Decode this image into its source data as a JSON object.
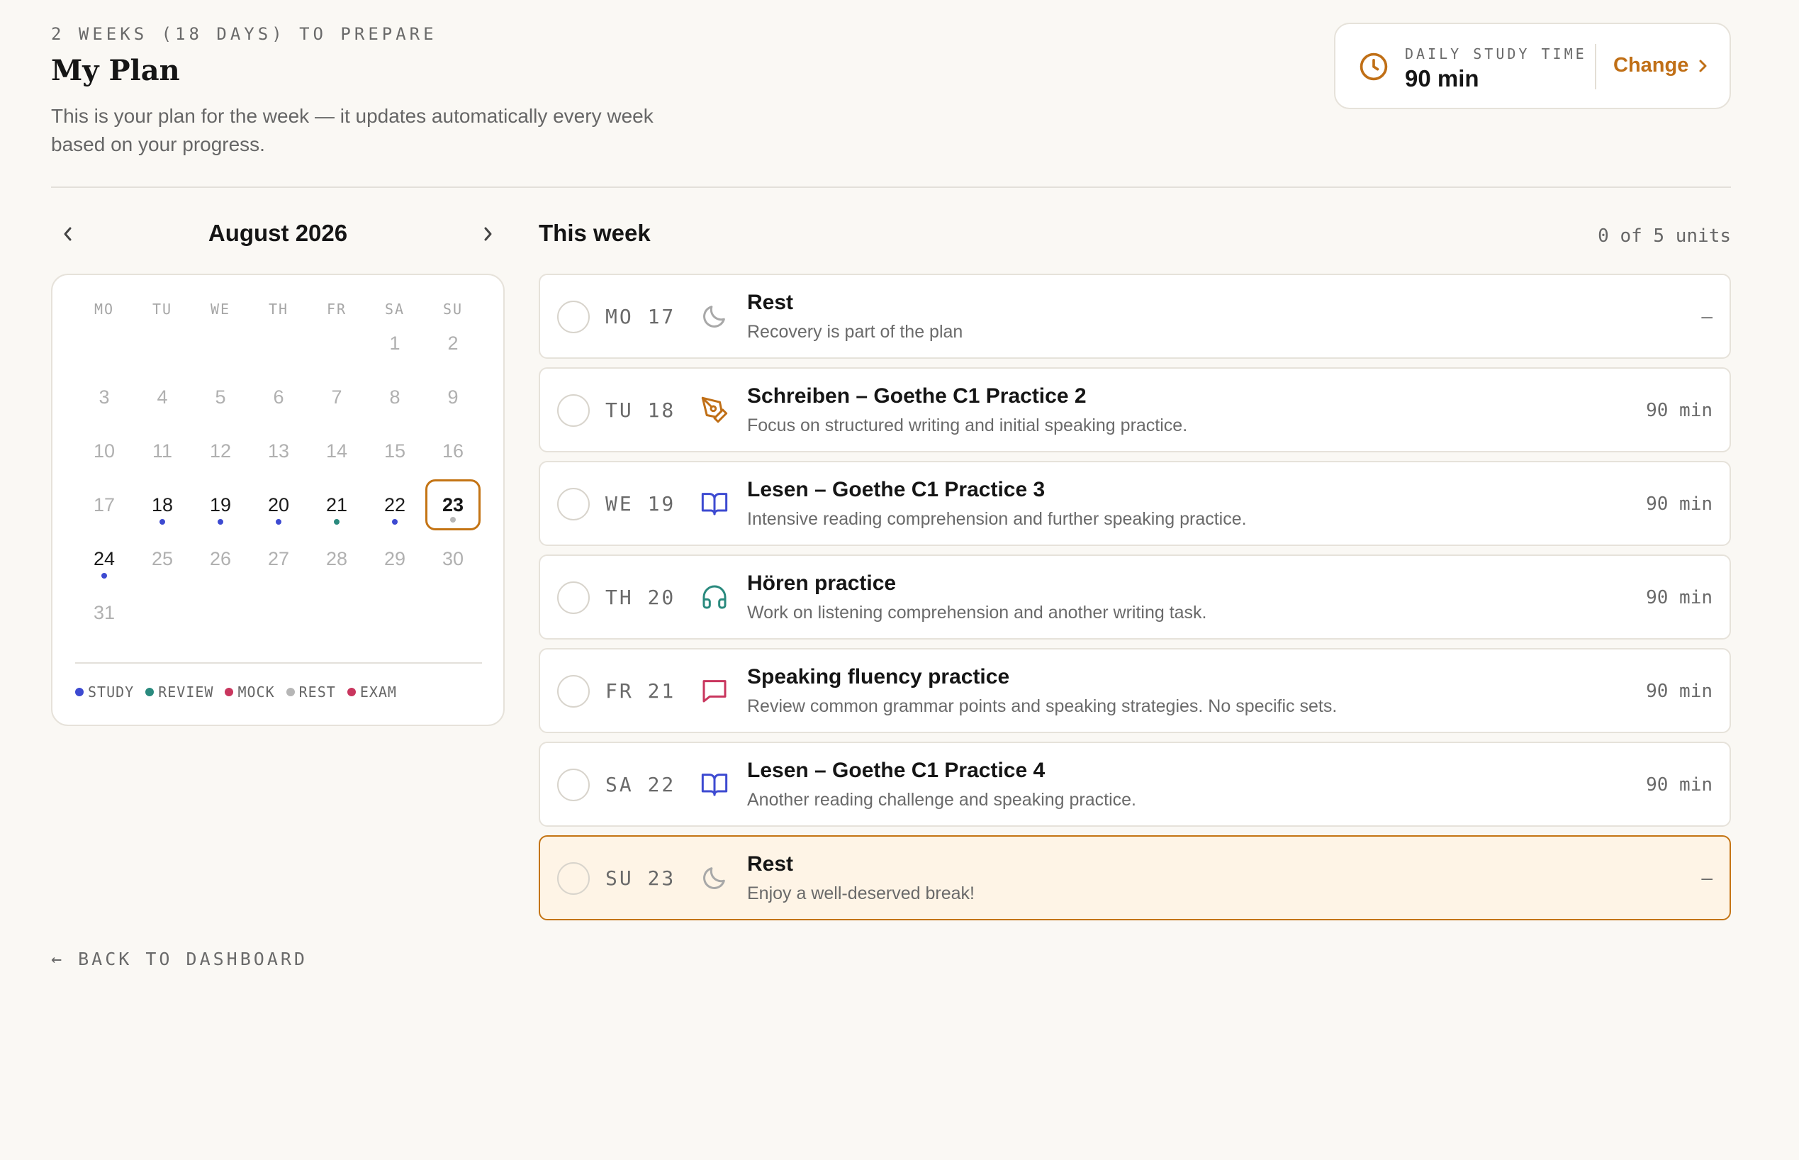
{
  "header": {
    "eyebrow": "2 WEEKS (18 DAYS) TO PREPARE",
    "title": "My Plan",
    "subtitle": "This is your plan for the week — it updates automatically every week based on your progress."
  },
  "study_time": {
    "icon": "clock-icon",
    "label": "DAILY STUDY TIME",
    "value": "90 min",
    "change_label": "Change"
  },
  "calendar": {
    "month": "August 2026",
    "weekdays": [
      "MO",
      "TU",
      "WE",
      "TH",
      "FR",
      "SA",
      "SU"
    ],
    "first_weekday_index": 5,
    "days": [
      {
        "d": "1",
        "active": false
      },
      {
        "d": "2",
        "active": false
      },
      {
        "d": "3",
        "active": false
      },
      {
        "d": "4",
        "active": false
      },
      {
        "d": "5",
        "active": false
      },
      {
        "d": "6",
        "active": false
      },
      {
        "d": "7",
        "active": false
      },
      {
        "d": "8",
        "active": false
      },
      {
        "d": "9",
        "active": false
      },
      {
        "d": "10",
        "active": false
      },
      {
        "d": "11",
        "active": false
      },
      {
        "d": "12",
        "active": false
      },
      {
        "d": "13",
        "active": false
      },
      {
        "d": "14",
        "active": false
      },
      {
        "d": "15",
        "active": false
      },
      {
        "d": "16",
        "active": false
      },
      {
        "d": "17",
        "active": false
      },
      {
        "d": "18",
        "active": true,
        "dot": "study"
      },
      {
        "d": "19",
        "active": true,
        "dot": "study"
      },
      {
        "d": "20",
        "active": true,
        "dot": "study"
      },
      {
        "d": "21",
        "active": true,
        "dot": "review"
      },
      {
        "d": "22",
        "active": true,
        "dot": "study"
      },
      {
        "d": "23",
        "active": true,
        "dot": "rest",
        "today": true
      },
      {
        "d": "24",
        "active": true,
        "dot": "study"
      },
      {
        "d": "25",
        "active": false
      },
      {
        "d": "26",
        "active": false
      },
      {
        "d": "27",
        "active": false
      },
      {
        "d": "28",
        "active": false
      },
      {
        "d": "29",
        "active": false
      },
      {
        "d": "30",
        "active": false
      },
      {
        "d": "31",
        "active": false
      }
    ],
    "legend": [
      {
        "key": "study",
        "label": "STUDY"
      },
      {
        "key": "review",
        "label": "REVIEW"
      },
      {
        "key": "mock",
        "label": "MOCK"
      },
      {
        "key": "rest",
        "label": "REST"
      },
      {
        "key": "exam",
        "label": "EXAM"
      }
    ]
  },
  "colors": {
    "study": "#3d4ad1",
    "review": "#2a8a7e",
    "mock": "#c9365e",
    "rest": "#b6b6b6",
    "exam": "#c9365e",
    "accent": "#c06f16"
  },
  "week": {
    "title": "This week",
    "count": "0 of 5 units",
    "units": [
      {
        "day": "MO 17",
        "icon": "moon-icon",
        "title": "Rest",
        "desc": "Recovery is part of the plan",
        "duration": "–"
      },
      {
        "day": "TU 18",
        "icon": "pen-icon",
        "title": "Schreiben – Goethe C1 Practice 2",
        "desc": "Focus on structured writing and initial speaking practice.",
        "duration": "90 min"
      },
      {
        "day": "WE 19",
        "icon": "book-icon",
        "title": "Lesen – Goethe C1 Practice 3",
        "desc": "Intensive reading comprehension and further speaking practice.",
        "duration": "90 min"
      },
      {
        "day": "TH 20",
        "icon": "headphones-icon",
        "title": "Hören practice",
        "desc": "Work on listening comprehension and another writing task.",
        "duration": "90 min"
      },
      {
        "day": "FR 21",
        "icon": "chat-icon",
        "title": "Speaking fluency practice",
        "desc": "Review common grammar points and speaking strategies. No specific sets.",
        "duration": "90 min"
      },
      {
        "day": "SA 22",
        "icon": "book-icon",
        "title": "Lesen – Goethe C1 Practice 4",
        "desc": "Another reading challenge and speaking practice.",
        "duration": "90 min"
      },
      {
        "day": "SU 23",
        "icon": "moon-icon",
        "title": "Rest",
        "desc": "Enjoy a well-deserved break!",
        "duration": "–",
        "today": true
      }
    ]
  },
  "footer": {
    "back_label": "← BACK TO DASHBOARD"
  }
}
